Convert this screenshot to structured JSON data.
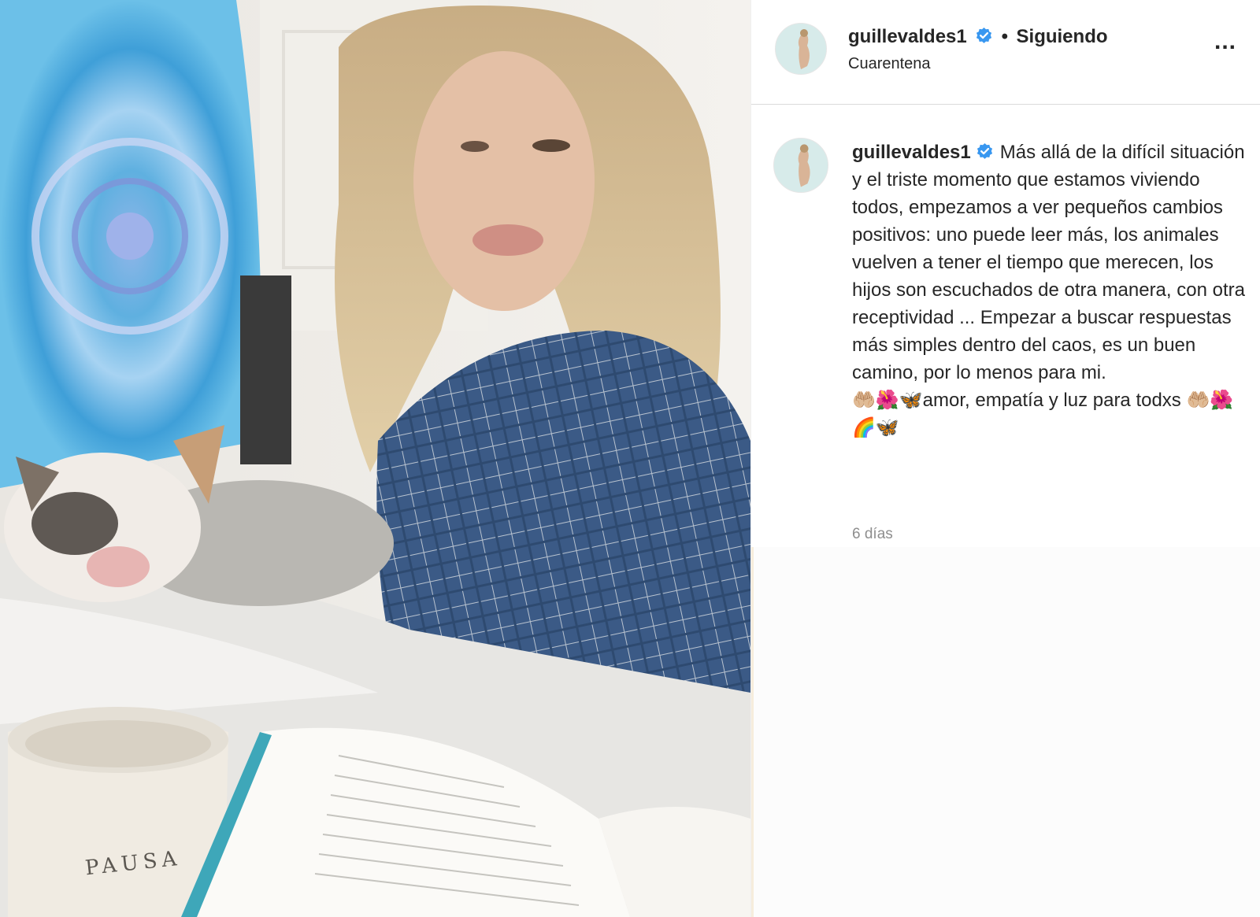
{
  "post": {
    "image_description_icon": "photo",
    "image_mug_text": "PAUSA"
  },
  "header": {
    "username": "guillevaldes1",
    "separator": "•",
    "follow_status": "Siguiendo",
    "location": "Cuarentena",
    "more_icon": "more-horizontal-icon",
    "more_label": "..."
  },
  "caption": {
    "username": "guillevaldes1",
    "text": "Más allá de la difícil situación y el triste momento que estamos viviendo todos, empezamos a ver pequeños cambios positivos: uno puede leer más, los animales vuelven a tener el tiempo que merecen, los hijos son escuchados de otra manera, con otra receptividad ... Empezar a buscar respuestas más simples dentro del caos, es un buen camino, por lo menos para mi.",
    "emoji_line": "🤲🏼🌺🦋amor, empatía y luz para todxs 🤲🏼🌺🌈🦋",
    "timestamp": "6 días"
  },
  "colors": {
    "verified": "#3897f0",
    "text": "#262626",
    "muted": "#8e8e8e",
    "divider": "#dbdbdb"
  }
}
